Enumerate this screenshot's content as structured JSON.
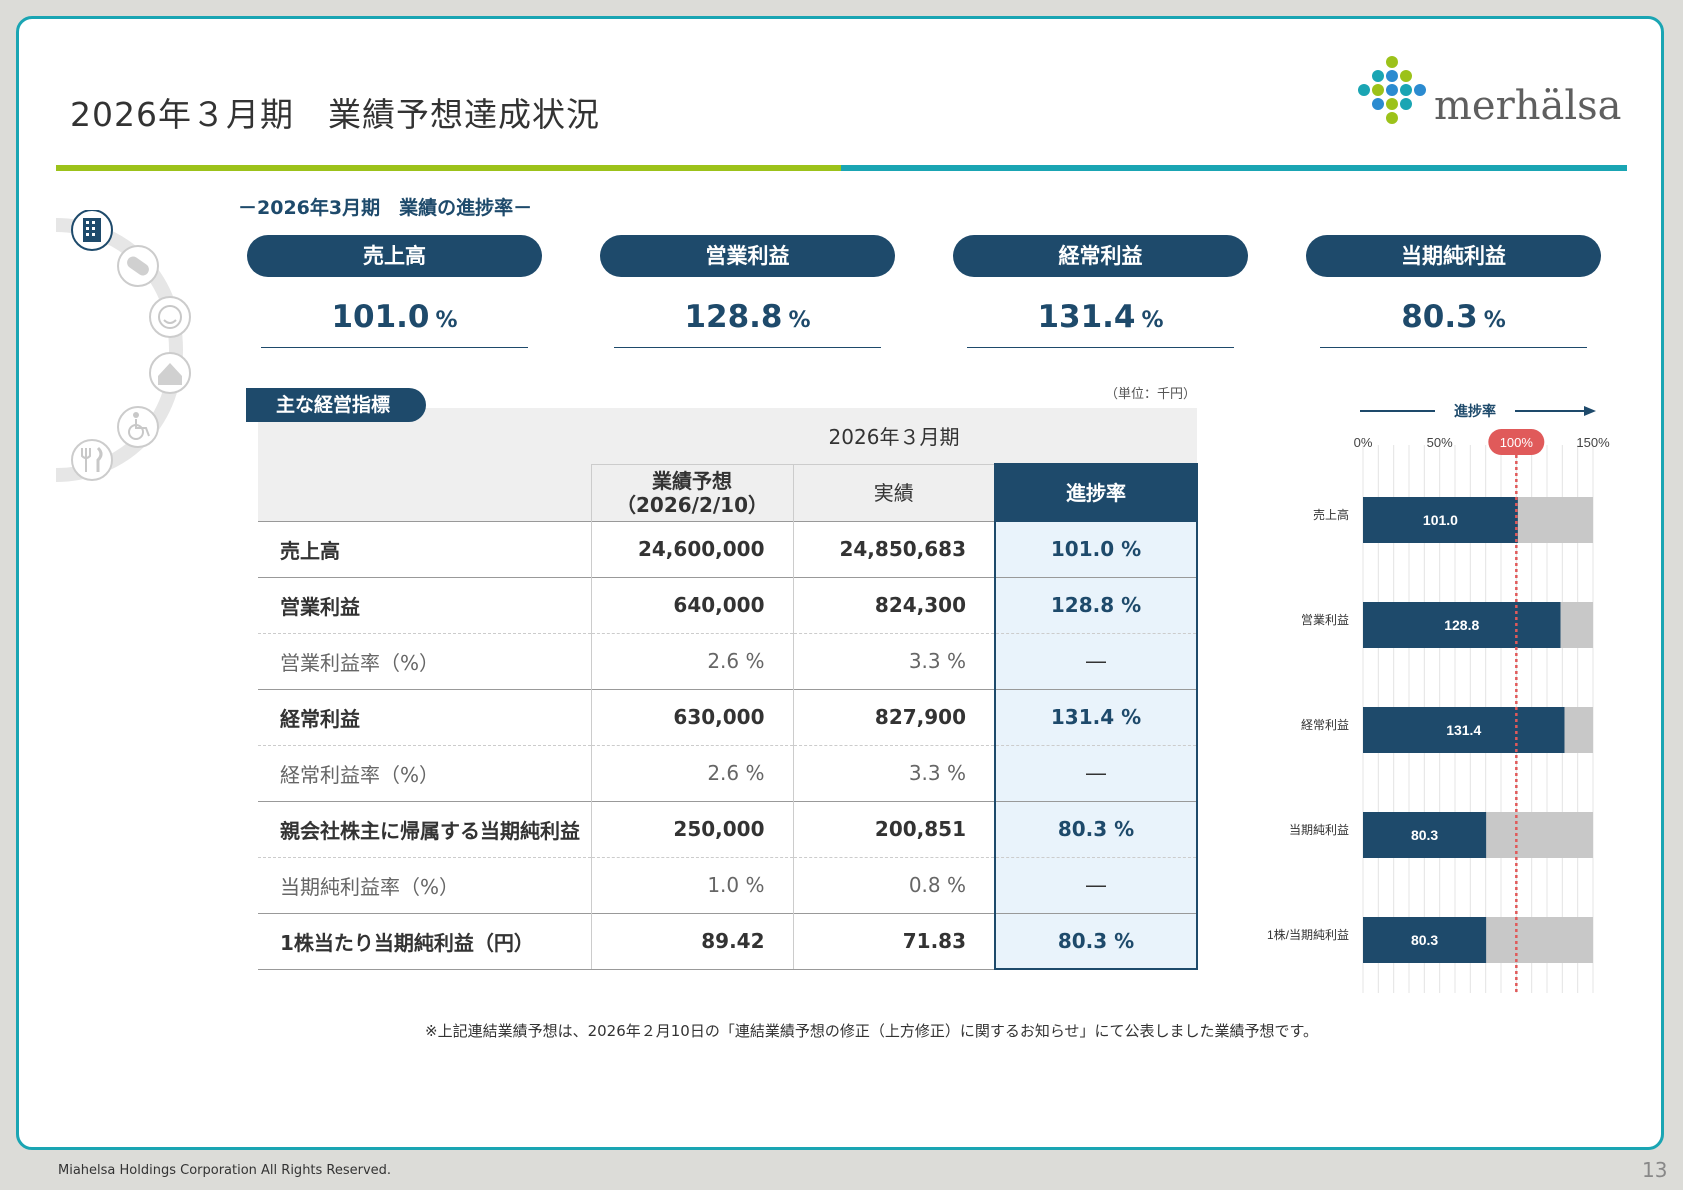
{
  "page_title": "2026年３月期　業績予想達成状況",
  "brand": {
    "logo_text": "merhälsa",
    "green": "#9cc21a",
    "teal": "#1aa5b3",
    "navy": "#1e4a6b",
    "blue": "#2b8bd0"
  },
  "subheading": "－2026年3月期　業績の進捗率－",
  "kpis": [
    {
      "label": "売上高",
      "value": "101.0",
      "unit": "%"
    },
    {
      "label": "営業利益",
      "value": "128.8",
      "unit": "%"
    },
    {
      "label": "経常利益",
      "value": "131.4",
      "unit": "%"
    },
    {
      "label": "当期純利益",
      "value": "80.3",
      "unit": "%"
    }
  ],
  "table": {
    "tag": "主な経営指標",
    "unit_note": "（単位：千円）",
    "period": "2026年３月期",
    "columns": {
      "forecast": "業績予想",
      "forecast_date": "（2026/2/10）",
      "actual": "実績",
      "progress": "進捗率"
    },
    "rows": [
      {
        "label": "売上高",
        "forecast": "24,600,000",
        "actual": "24,850,683",
        "progress": "101.0 %"
      },
      {
        "label": "営業利益",
        "forecast": "640,000",
        "actual": "824,300",
        "progress": "128.8 %"
      },
      {
        "label": "営業利益率（%）",
        "forecast": "2.6 %",
        "actual": "3.3 %",
        "progress": "―"
      },
      {
        "label": "経常利益",
        "forecast": "630,000",
        "actual": "827,900",
        "progress": "131.4 %"
      },
      {
        "label": "経常利益率（%）",
        "forecast": "2.6 %",
        "actual": "3.3 %",
        "progress": "―"
      },
      {
        "label": "親会社株主に帰属する当期純利益",
        "forecast": "250,000",
        "actual": "200,851",
        "progress": "80.3 %"
      },
      {
        "label": "当期純利益率（%）",
        "forecast": "1.0 %",
        "actual": "0.8 %",
        "progress": "―"
      },
      {
        "label": "1株当たり当期純利益（円）",
        "forecast": "89.42",
        "actual": "71.83",
        "progress": "80.3 %"
      }
    ]
  },
  "chart_data": {
    "type": "bar",
    "orientation": "horizontal",
    "axis_title": "進捗率",
    "ticks": [
      "0%",
      "50%",
      "100%",
      "150%"
    ],
    "xlim": [
      0,
      150
    ],
    "reference_line": 100,
    "reference_label": "100%",
    "categories": [
      "売上高",
      "営業利益",
      "経常利益",
      "当期純利益",
      "1株/当期純利益"
    ],
    "values": [
      101.0,
      128.8,
      131.4,
      80.3,
      80.3
    ],
    "value_labels": [
      "101.0",
      "128.8",
      "131.4",
      "80.3",
      "80.3"
    ],
    "bar_color": "#1e4a6b",
    "track_color": "#c8c8c8",
    "reference_color": "#e05a5a"
  },
  "footnote": "※上記連結業績予想は、2026年２月10日の「連結業績予想の修正（上方修正）に関するお知らせ」にて公表しました業績予想です。",
  "copyright": "Miahelsa Holdings Corporation All Rights Reserved.",
  "page_number": "13"
}
